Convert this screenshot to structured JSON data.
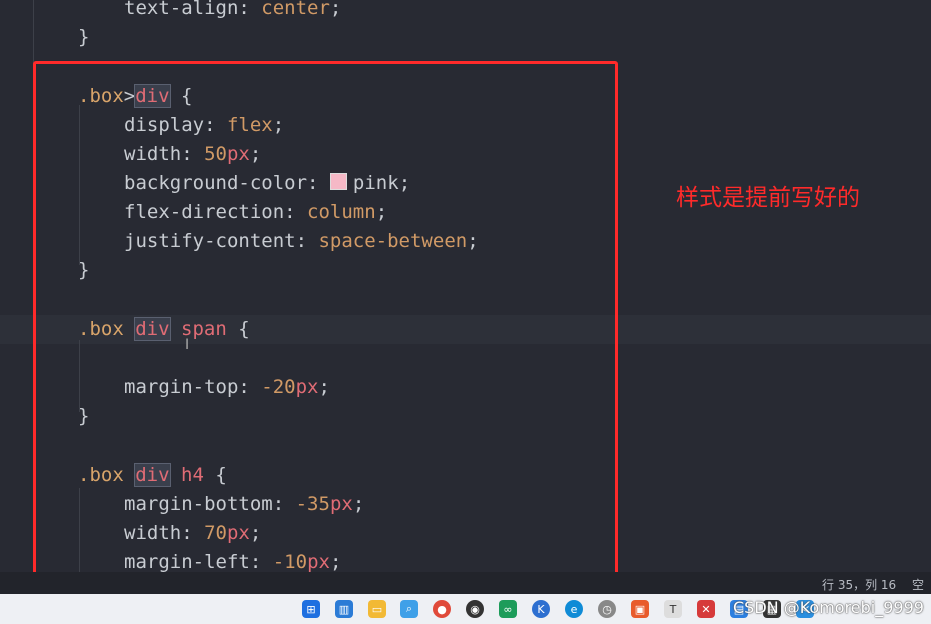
{
  "editor": {
    "lines": {
      "l1": {
        "prop": "text-align",
        "value": "center"
      },
      "l2": {
        "brace": "}"
      },
      "l3": {
        "sel_class": ".box",
        "combinator": ">",
        "sel_tag": "div",
        "open": "{"
      },
      "l4": {
        "prop": "display",
        "value": "flex"
      },
      "l5": {
        "prop": "width",
        "num": "50",
        "unit": "px"
      },
      "l6": {
        "prop": "background-color",
        "value": "pink"
      },
      "l7": {
        "prop": "flex-direction",
        "value": "column"
      },
      "l8": {
        "prop": "justify-content",
        "value": "space-between"
      },
      "l9": {
        "brace": "}"
      },
      "l10": {
        "sel_class": ".box",
        "sel_tag": "div",
        "sel_tag2": "span",
        "open": "{"
      },
      "l11": {
        "prop": "margin-top",
        "num": "-20",
        "unit": "px"
      },
      "l12": {
        "brace": "}"
      },
      "l13": {
        "sel_class": ".box",
        "sel_tag": "div",
        "sel_tag2": "h4",
        "open": "{"
      },
      "l14": {
        "prop": "margin-bottom",
        "num": "-35",
        "unit": "px"
      },
      "l15": {
        "prop": "width",
        "num": "70",
        "unit": "px"
      },
      "l16": {
        "prop": "margin-left",
        "num": "-10",
        "unit": "px"
      }
    },
    "swatch_color": "#f5b8c6"
  },
  "annotation": {
    "text": "样式是提前写好的",
    "color": "#ff2a2a"
  },
  "statusbar": {
    "position": "行 35，列 16",
    "encoding": "空格"
  },
  "taskbar": {
    "icons": [
      "windows-start-icon",
      "explorer-icon",
      "folder-icon",
      "search-icon",
      "chrome-icon",
      "obs-icon",
      "codeleft-icon",
      "k-app-icon",
      "edge-icon",
      "clock-app-icon",
      "slides-app-icon",
      "typora-icon",
      "xmind-icon",
      "camera-icon",
      "box-app-icon",
      "vscode-icon"
    ]
  },
  "watermark": "CSDN @Komorebi_9999"
}
